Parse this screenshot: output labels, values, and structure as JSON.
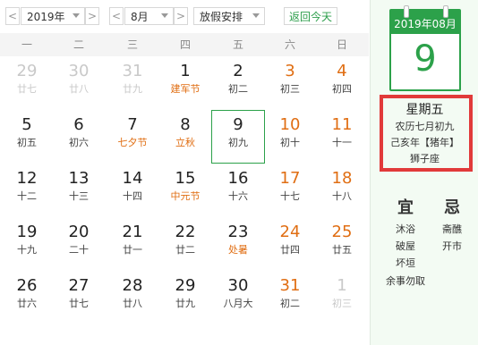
{
  "toolbar": {
    "prev_arrow": "<",
    "next_arrow": ">",
    "year": "2019年",
    "month": "8月",
    "holiday": "放假安排",
    "today": "返回今天"
  },
  "weekdays": [
    "一",
    "二",
    "三",
    "四",
    "五",
    "六",
    "日"
  ],
  "weeks": [
    [
      {
        "n": "29",
        "l": "廿七",
        "dim": true
      },
      {
        "n": "30",
        "l": "廿八",
        "dim": true
      },
      {
        "n": "31",
        "l": "廿九",
        "dim": true
      },
      {
        "n": "1",
        "l": "建军节",
        "holiday": true
      },
      {
        "n": "2",
        "l": "初二"
      },
      {
        "n": "3",
        "l": "初三",
        "weekend": true
      },
      {
        "n": "4",
        "l": "初四",
        "weekend": true
      }
    ],
    [
      {
        "n": "5",
        "l": "初五"
      },
      {
        "n": "6",
        "l": "初六"
      },
      {
        "n": "7",
        "l": "七夕节",
        "holiday": true
      },
      {
        "n": "8",
        "l": "立秋",
        "holiday": true
      },
      {
        "n": "9",
        "l": "初九",
        "selected": true
      },
      {
        "n": "10",
        "l": "初十",
        "weekend": true
      },
      {
        "n": "11",
        "l": "十一",
        "weekend": true
      }
    ],
    [
      {
        "n": "12",
        "l": "十二"
      },
      {
        "n": "13",
        "l": "十三"
      },
      {
        "n": "14",
        "l": "十四"
      },
      {
        "n": "15",
        "l": "中元节",
        "holiday": true
      },
      {
        "n": "16",
        "l": "十六"
      },
      {
        "n": "17",
        "l": "十七",
        "weekend": true
      },
      {
        "n": "18",
        "l": "十八",
        "weekend": true
      }
    ],
    [
      {
        "n": "19",
        "l": "十九"
      },
      {
        "n": "20",
        "l": "二十"
      },
      {
        "n": "21",
        "l": "廿一"
      },
      {
        "n": "22",
        "l": "廿二"
      },
      {
        "n": "23",
        "l": "处暑",
        "holiday": true
      },
      {
        "n": "24",
        "l": "廿四",
        "weekend": true
      },
      {
        "n": "25",
        "l": "廿五",
        "weekend": true
      }
    ],
    [
      {
        "n": "26",
        "l": "廿六"
      },
      {
        "n": "27",
        "l": "廿七"
      },
      {
        "n": "28",
        "l": "廿八"
      },
      {
        "n": "29",
        "l": "廿九"
      },
      {
        "n": "30",
        "l": "八月大"
      },
      {
        "n": "31",
        "l": "初二",
        "weekend": true
      },
      {
        "n": "1",
        "l": "初三",
        "dim": true
      }
    ]
  ],
  "panel": {
    "calendar_header": "2019年08月",
    "big_day": "9",
    "weekday": "星期五",
    "lunar_date": "农历七月初九",
    "ganzhi": "己亥年【猪年】",
    "zodiac": "狮子座",
    "yi_label": "宜",
    "ji_label": "忌",
    "yi_items": [
      "沐浴",
      "破屋",
      "坏垣",
      "余事勿取"
    ],
    "ji_items": [
      "斋醮",
      "开市"
    ]
  },
  "colors": {
    "accent_green": "#2ca14a",
    "weekend_orange": "#e06e13",
    "highlight_red": "#e13a3a"
  }
}
